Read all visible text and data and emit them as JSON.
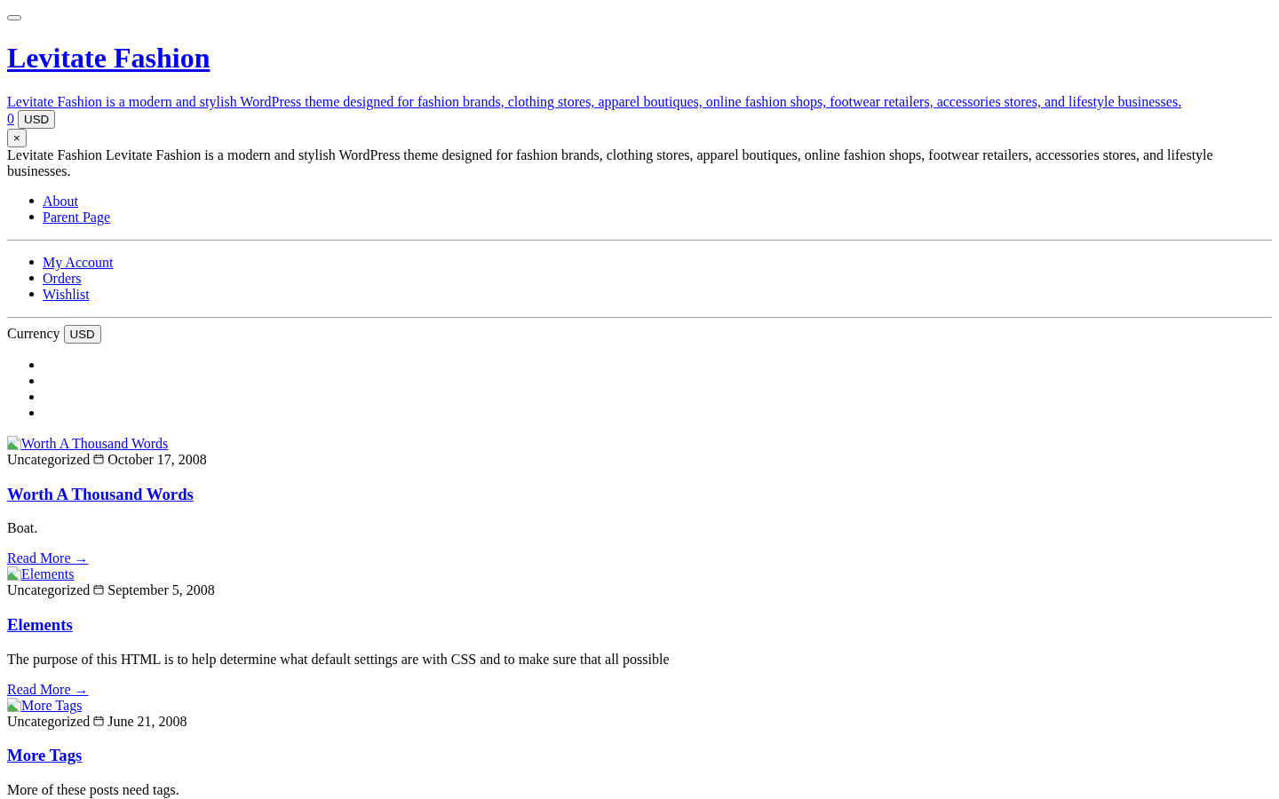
{
  "site_title": "Levitate Fashion",
  "tagline": "Levitate Fashion is a modern and stylish WordPress theme designed for fashion brands, clothing stores, apparel boutiques, online fashion shops, footwear retailers, accessories stores, and lifestyle businesses.",
  "cart": {
    "count": "0",
    "currency_button": "USD"
  },
  "close_button": "×",
  "panel_description": "Levitate Fashion Levitate Fashion is a modern and stylish WordPress theme designed for fashion brands, clothing stores, apparel boutiques, online fashion shops, footwear retailers, accessories stores, and lifestyle businesses.",
  "primary_menu": [
    "About",
    "Parent Page"
  ],
  "account_menu": [
    "My Account",
    "Orders",
    "Wishlist"
  ],
  "currency": {
    "label": "Currency",
    "button": "USD"
  },
  "empty_list": [
    {
      "kind": "bullet"
    },
    {
      "kind": "bullet"
    },
    {
      "kind": "bullet"
    },
    {
      "kind": "bullet"
    }
  ],
  "posts": [
    {
      "image_alt": "Worth A Thousand Words",
      "category": "Uncategorized",
      "date": "October 17, 2008",
      "title": "Worth A Thousand Words",
      "excerpt": "Boat.",
      "read_more": "Read More →"
    },
    {
      "image_alt": "Elements",
      "category": "Uncategorized",
      "date": "September 5, 2008",
      "title": "Elements",
      "excerpt": "The purpose of this HTML is to help determine what default settings are with CSS and to make sure that all possible",
      "read_more": "Read More →"
    },
    {
      "image_alt": "More Tags",
      "category": "Uncategorized",
      "date": "June 21, 2008",
      "title": "More Tags",
      "excerpt": "More of these posts need tags."
    }
  ]
}
